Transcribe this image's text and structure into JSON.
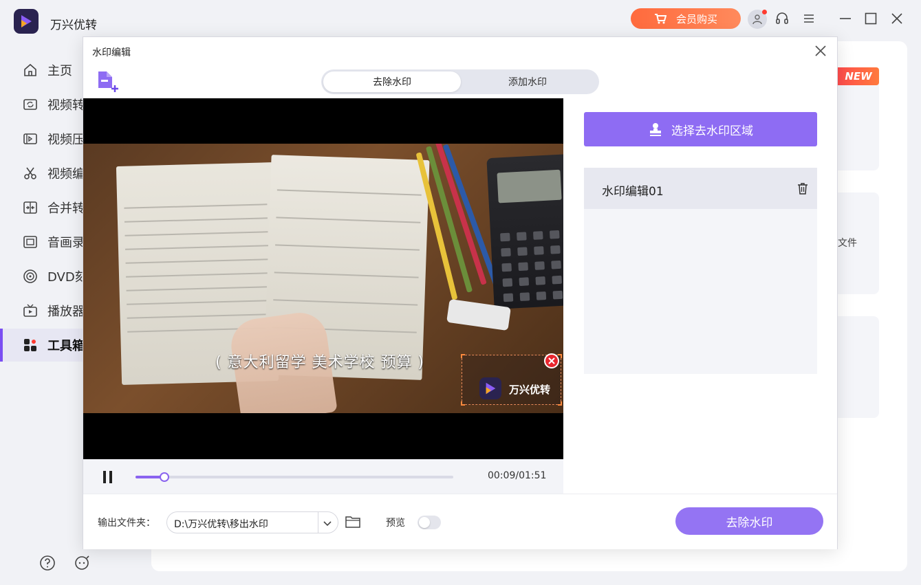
{
  "app": {
    "name": "万兴优转"
  },
  "header": {
    "vip_label": "会员购买"
  },
  "sidebar": {
    "items": [
      {
        "label": "主页",
        "icon": "home-icon"
      },
      {
        "label": "视频转",
        "icon": "video-convert-icon"
      },
      {
        "label": "视频压",
        "icon": "video-compress-icon"
      },
      {
        "label": "视频编",
        "icon": "scissors-icon"
      },
      {
        "label": "合并转",
        "icon": "merge-icon"
      },
      {
        "label": "音画录",
        "icon": "record-icon"
      },
      {
        "label": "DVD刻",
        "icon": "disc-icon"
      },
      {
        "label": "播放器",
        "icon": "tv-icon"
      },
      {
        "label": "工具箱",
        "icon": "toolbox-icon",
        "active": true
      }
    ]
  },
  "main": {
    "new_badge": "NEW",
    "peek_text": "文件"
  },
  "dialog": {
    "title": "水印编辑",
    "tabs": [
      {
        "label": "去除水印",
        "active": true
      },
      {
        "label": "添加水印",
        "active": false
      }
    ],
    "video": {
      "subtitle": "( 意大利留学 美术学校 预算 )",
      "watermark_text": "万兴优转"
    },
    "player": {
      "time": "00:09/01:51",
      "progress": 0.09
    },
    "select_area_label": "选择去水印区域",
    "watermark_list": [
      {
        "label": "水印编辑01"
      }
    ],
    "output": {
      "label": "输出文件夹：",
      "path": "D:\\万兴优转\\移出水印",
      "preview_label": "预览",
      "preview_on": false
    },
    "remove_button": "去除水印"
  },
  "colors": {
    "accent": "#8e6cf3",
    "vip": "#ff6a3d",
    "danger": "#e8262e"
  }
}
